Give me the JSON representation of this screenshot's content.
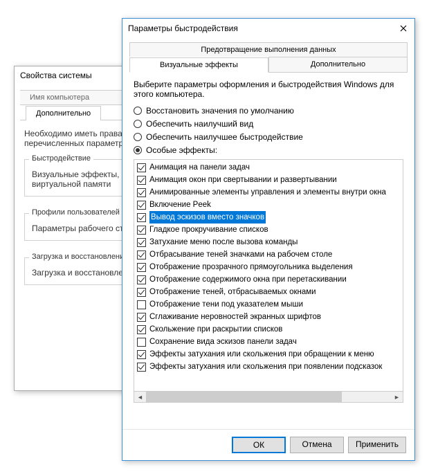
{
  "back": {
    "title": "Свойства системы",
    "tabs": {
      "name": "Имя компьютера",
      "advanced": "Дополнительно"
    },
    "note": "Необходимо иметь права администратора для изменения перечисленных параметров.",
    "group_perf": {
      "legend": "Быстродействие",
      "text": "Визуальные эффекты, использование процессора, виртуальной памяти"
    },
    "group_profiles": {
      "legend": "Профили пользователей",
      "text": "Параметры рабочего стола"
    },
    "group_startup": {
      "legend": "Загрузка и восстановление",
      "text": "Загрузка и восстановление"
    }
  },
  "front": {
    "title": "Параметры быстродействия",
    "tabs": {
      "dep": "Предотвращение выполнения данных",
      "visual": "Визуальные эффекты",
      "advanced": "Дополнительно"
    },
    "intro": "Выберите параметры оформления и быстродействия Windows для этого компьютера.",
    "radios": {
      "restore": "Восстановить значения по умолчанию",
      "best_look": "Обеспечить наилучший вид",
      "best_perf": "Обеспечить наилучшее быстродействие",
      "custom": "Особые эффекты:"
    },
    "selected_radio": "custom",
    "effects": [
      {
        "checked": true,
        "selected": false,
        "label": "Анимация на панели задач"
      },
      {
        "checked": true,
        "selected": false,
        "label": "Анимация окон при свертывании и развертывании"
      },
      {
        "checked": true,
        "selected": false,
        "label": "Анимированные элементы управления и элементы внутри окна"
      },
      {
        "checked": true,
        "selected": false,
        "label": "Включение Peek"
      },
      {
        "checked": true,
        "selected": true,
        "label": "Вывод эскизов вместо значков"
      },
      {
        "checked": true,
        "selected": false,
        "label": "Гладкое прокручивание списков"
      },
      {
        "checked": true,
        "selected": false,
        "label": "Затухание меню после вызова команды"
      },
      {
        "checked": true,
        "selected": false,
        "label": "Отбрасывание теней значками на рабочем столе"
      },
      {
        "checked": true,
        "selected": false,
        "label": "Отображение прозрачного прямоугольника выделения"
      },
      {
        "checked": true,
        "selected": false,
        "label": "Отображение содержимого окна при перетаскивании"
      },
      {
        "checked": true,
        "selected": false,
        "label": "Отображение теней, отбрасываемых окнами"
      },
      {
        "checked": false,
        "selected": false,
        "label": "Отображение тени под указателем мыши"
      },
      {
        "checked": true,
        "selected": false,
        "label": "Сглаживание неровностей экранных шрифтов"
      },
      {
        "checked": true,
        "selected": false,
        "label": "Скольжение при раскрытии списков"
      },
      {
        "checked": false,
        "selected": false,
        "label": "Сохранение вида эскизов панели задач"
      },
      {
        "checked": true,
        "selected": false,
        "label": "Эффекты затухания или скольжения при обращении к меню"
      },
      {
        "checked": true,
        "selected": false,
        "label": "Эффекты затухания или скольжения при появлении подсказок"
      }
    ],
    "buttons": {
      "ok": "ОК",
      "cancel": "Отмена",
      "apply": "Применить"
    }
  }
}
